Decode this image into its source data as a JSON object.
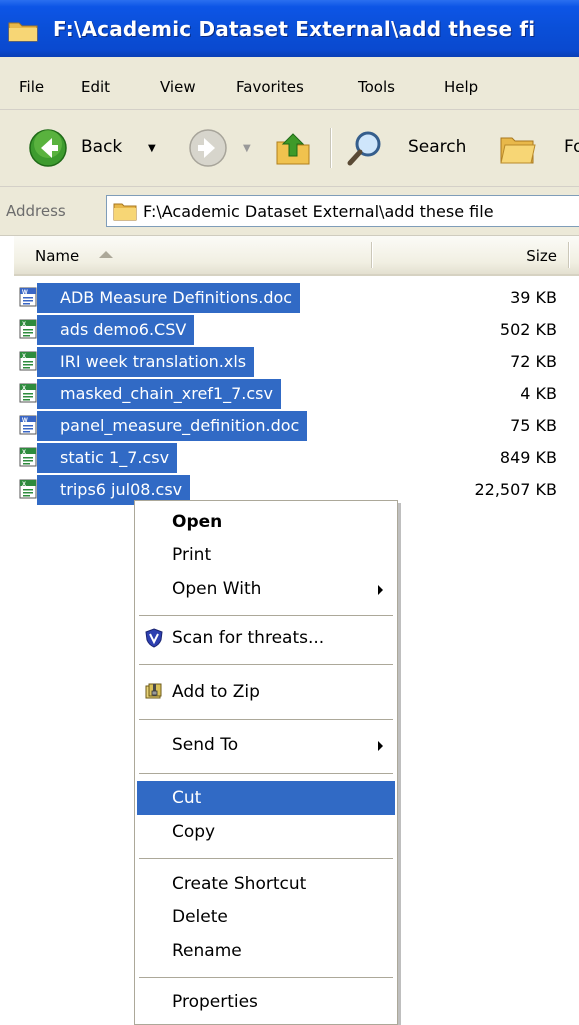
{
  "window": {
    "title": "F:\\Academic Dataset External\\add these fi"
  },
  "menu": [
    "File",
    "Edit",
    "View",
    "Favorites",
    "Tools",
    "Help"
  ],
  "toolbar": {
    "back_label": "Back",
    "search_label": "Search",
    "folders_label": "Fo"
  },
  "address": {
    "label": "Address",
    "path": "F:\\Academic Dataset External\\add these file"
  },
  "columns": {
    "name": "Name",
    "size": "Size"
  },
  "files": [
    {
      "name": "ADB Measure Definitions.doc",
      "size": "39 KB",
      "icon": "word-doc-icon"
    },
    {
      "name": "ads demo6.CSV",
      "size": "502 KB",
      "icon": "excel-csv-icon"
    },
    {
      "name": "IRI week translation.xls",
      "size": "72 KB",
      "icon": "excel-xls-icon"
    },
    {
      "name": "masked_chain_xref1_7.csv",
      "size": "4 KB",
      "icon": "excel-csv-icon"
    },
    {
      "name": "panel_measure_definition.doc",
      "size": "75 KB",
      "icon": "word-doc-icon"
    },
    {
      "name": "static 1_7.csv",
      "size": "849 KB",
      "icon": "excel-csv-icon"
    },
    {
      "name": "trips6 jul08.csv",
      "size": "22,507 KB",
      "icon": "excel-csv-icon"
    }
  ],
  "context_menu": {
    "open": "Open",
    "print": "Print",
    "open_with": "Open With",
    "scan": "Scan for threats...",
    "add_zip": "Add to Zip",
    "send_to": "Send To",
    "cut": "Cut",
    "copy": "Copy",
    "create_shortcut": "Create Shortcut",
    "delete": "Delete",
    "rename": "Rename",
    "properties": "Properties"
  },
  "colors": {
    "selection": "#316ac5",
    "titlebar": "#0a4fd8",
    "chrome": "#ece9d8"
  }
}
